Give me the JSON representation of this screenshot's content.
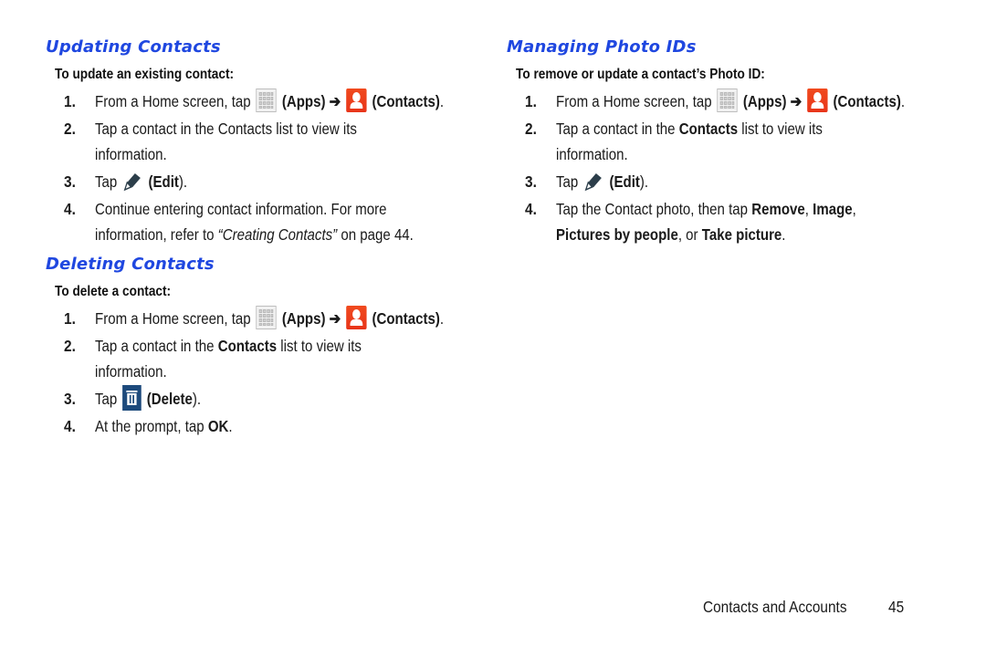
{
  "left_column": {
    "updating": {
      "heading": "Updating Contacts",
      "subheading": "To update an existing contact:",
      "steps": [
        {
          "num": "1.",
          "pre": "From a Home screen, tap",
          "apps": "(Apps)",
          "arrow": "➔",
          "contacts": "(Contacts)",
          "end": "."
        },
        {
          "num": "2.",
          "line1": "Tap a contact in the Contacts list to view its",
          "line2": "information."
        },
        {
          "num": "3.",
          "pre": "Tap",
          "bold": "(Edit",
          "end": ")."
        },
        {
          "num": "4.",
          "line1": "Continue entering contact information. For more",
          "line2_pre": "information, refer to ",
          "line2_ital": "“Creating Contacts”",
          "line2_post": " on page 44."
        }
      ]
    },
    "deleting": {
      "heading": "Deleting Contacts",
      "subheading": "To delete a contact:",
      "steps": [
        {
          "num": "1.",
          "pre": "From a Home screen, tap",
          "apps": "(Apps)",
          "arrow": "➔",
          "contacts": "(Contacts)",
          "end": "."
        },
        {
          "num": "2.",
          "pre": "Tap a contact in the ",
          "bold": "Contacts",
          "post": " list to view its",
          "line2": "information."
        },
        {
          "num": "3.",
          "pre": "Tap",
          "bold": "(Delete",
          "end": ")."
        },
        {
          "num": "4.",
          "pre": "At the prompt, tap ",
          "bold": "OK",
          "end": "."
        }
      ]
    }
  },
  "right_column": {
    "photo_ids": {
      "heading": "Managing Photo IDs",
      "subheading": "To remove or update a contact’s Photo ID:",
      "steps": [
        {
          "num": "1.",
          "pre": "From a Home screen, tap",
          "apps": "(Apps)",
          "arrow": "➔",
          "contacts": "(Contacts)",
          "end": "."
        },
        {
          "num": "2.",
          "pre": "Tap a contact in the ",
          "bold": "Contacts",
          "post": " list to view its",
          "line2": "information."
        },
        {
          "num": "3.",
          "pre": "Tap",
          "bold": "(Edit",
          "end": ")."
        },
        {
          "num": "4.",
          "pre": "Tap the Contact photo, then tap ",
          "b1": "Remove",
          "s1": ", ",
          "b2": "Image",
          "s2": ",",
          "b3": "Pictures by people",
          "s3": ", or ",
          "b4": "Take picture",
          "end": "."
        }
      ]
    }
  },
  "footer": {
    "section": "Contacts and Accounts",
    "page": "45"
  },
  "icons": {
    "apps": "apps-grid-icon",
    "contacts": "contacts-person-icon",
    "edit": "pencil-edit-icon",
    "delete": "trash-delete-icon"
  },
  "colors": {
    "heading": "#1f47e0",
    "contacts_icon": "#e8351a",
    "delete_icon": "#1d4a7c",
    "edit_icon": "#2c3e4a"
  }
}
